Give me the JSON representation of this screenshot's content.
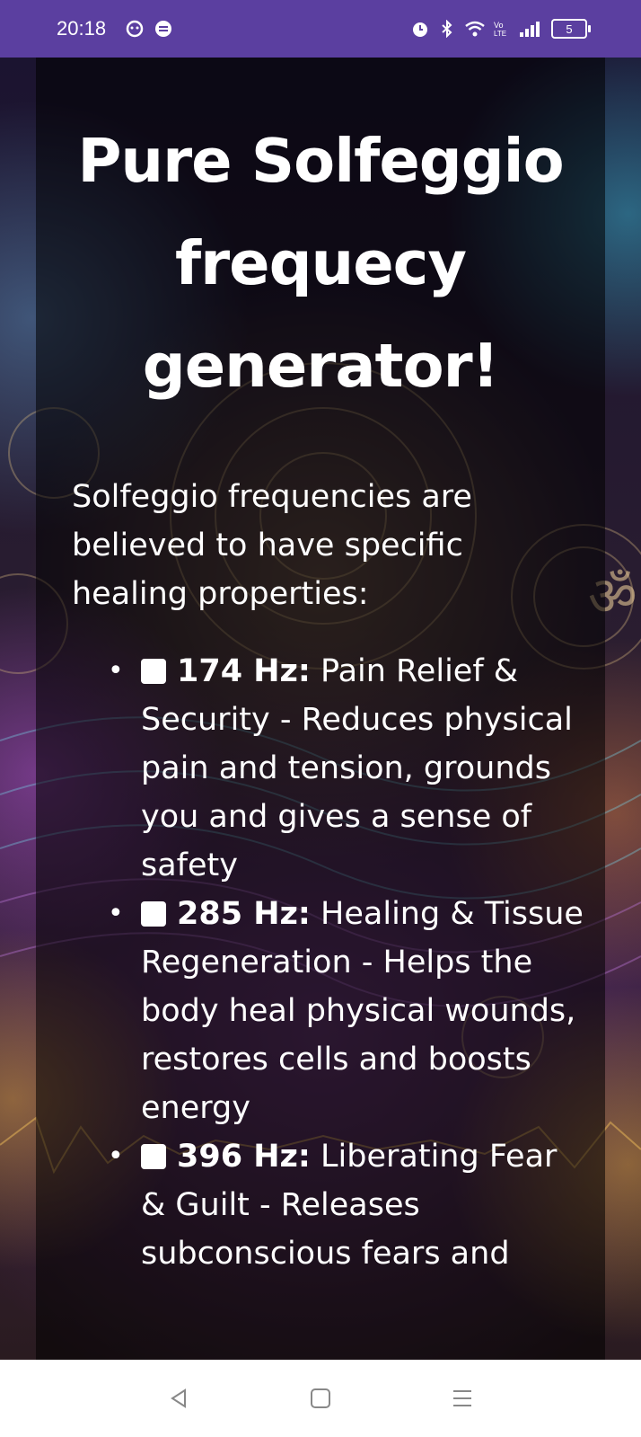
{
  "status_bar": {
    "time": "20:18",
    "left_icons": [
      "notification-icon",
      "app-icon"
    ],
    "right_icons": [
      "alarm-icon",
      "bluetooth-icon",
      "wifi-icon",
      "volte-icon",
      "signal-icon"
    ],
    "battery_level": "5"
  },
  "page": {
    "title": "Pure Solfeggio frequecy generator!",
    "intro": "Solfeggio frequencies are believed to have specific healing properties:",
    "frequencies": [
      {
        "hz": "174 Hz:",
        "description": "Pain Relief & Security - Reduces physical pain and tension, grounds you and gives a sense of safety",
        "checked": false
      },
      {
        "hz": "285 Hz:",
        "description": "Healing & Tissue Regeneration - Helps the body heal physical wounds, restores cells and boosts energy",
        "checked": false
      },
      {
        "hz": "396 Hz:",
        "description": "Liberating Fear & Guilt - Releases subconscious fears and",
        "checked": false
      }
    ]
  },
  "nav_bar": {
    "buttons": [
      "back-icon",
      "home-icon",
      "menu-icon"
    ]
  },
  "colors": {
    "status_bar": "#5b3fa0",
    "text": "#ffffff",
    "nav_bar": "#ffffff"
  }
}
